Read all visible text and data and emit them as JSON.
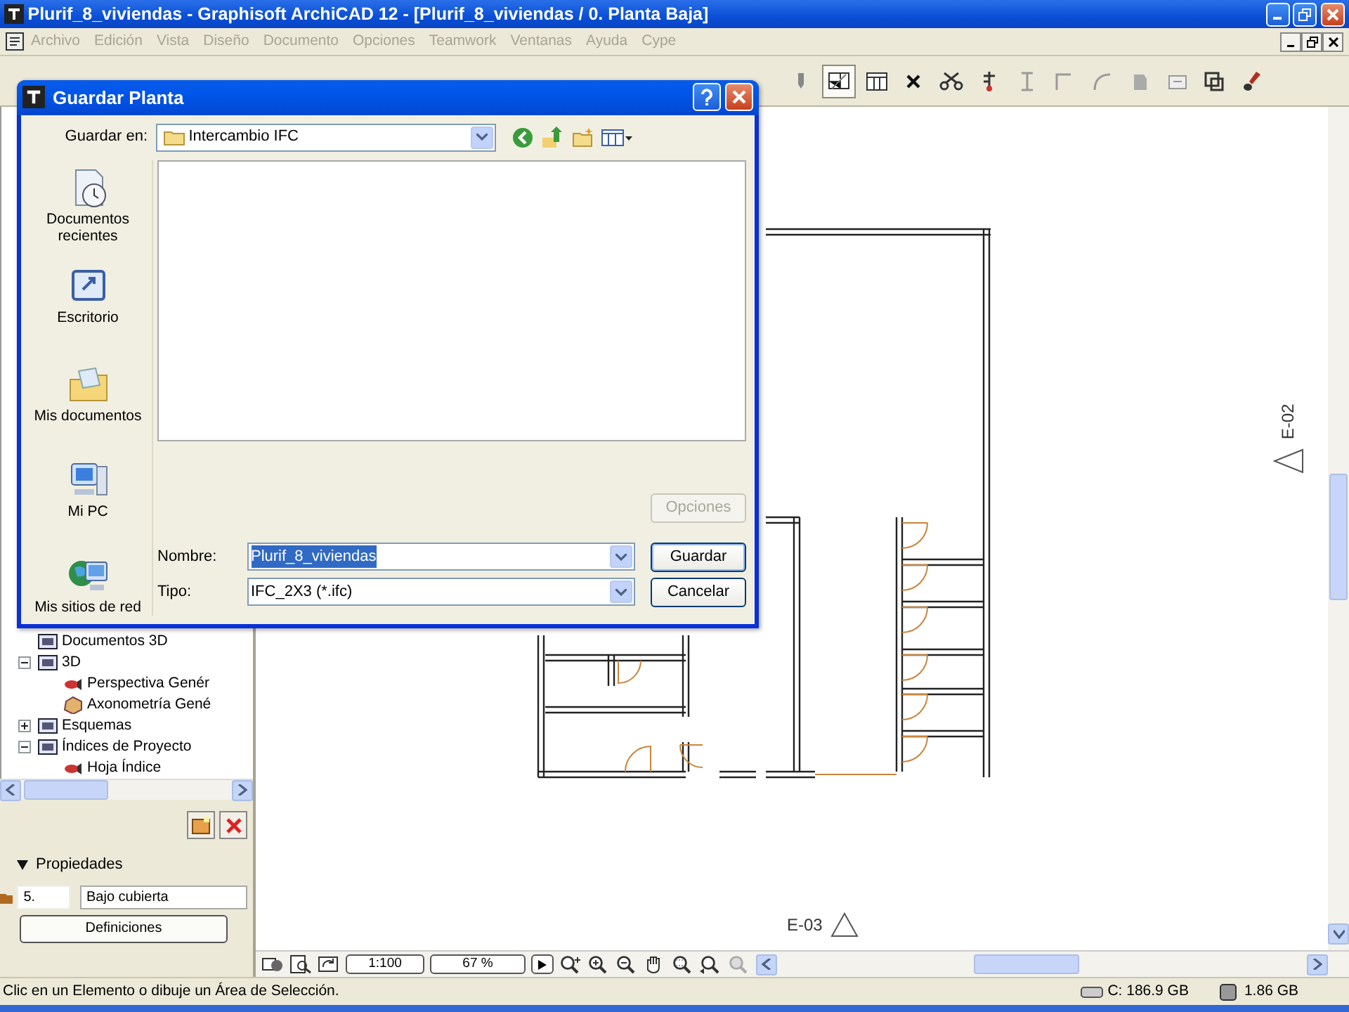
{
  "window": {
    "title": "Plurif_8_viviendas - Graphisoft ArchiCAD 12 - [Plurif_8_viviendas / 0. Planta Baja]"
  },
  "menu": [
    {
      "label": "Archivo",
      "disabled": true
    },
    {
      "label": "Edición",
      "disabled": true
    },
    {
      "label": "Vista",
      "disabled": true
    },
    {
      "label": "Diseño",
      "disabled": true
    },
    {
      "label": "Documento",
      "disabled": true
    },
    {
      "label": "Opciones",
      "disabled": true
    },
    {
      "label": "Teamwork",
      "disabled": true
    },
    {
      "label": "Ventanas",
      "disabled": true
    },
    {
      "label": "Ayuda",
      "disabled": true
    },
    {
      "label": "Cype",
      "disabled": true
    }
  ],
  "navigator": {
    "tree": [
      {
        "label": "Documentos 3D"
      },
      {
        "label": "3D",
        "expanded": true,
        "children": [
          {
            "label": "Perspectiva Genér"
          },
          {
            "label": "Axonometría Gené"
          }
        ]
      },
      {
        "label": "Esquemas",
        "expanded": false
      },
      {
        "label": "Índices de Proyecto",
        "expanded": true,
        "children": [
          {
            "label": "Hoja Índice"
          }
        ]
      }
    ]
  },
  "properties": {
    "header": "Propiedades",
    "expanded": true,
    "number": "5.",
    "name": "Bajo cubierta",
    "button": "Definiciones"
  },
  "canvas": {
    "markers": [
      {
        "label": "E-02",
        "kind": "vertical"
      },
      {
        "label": "E-03",
        "kind": "horizontal"
      }
    ]
  },
  "view_bar": {
    "scale": "1:100",
    "zoom": "67 %"
  },
  "status_bar": {
    "message": "Clic en un Elemento o dibuje un Área de Selección.",
    "disk": "C: 186.9 GB",
    "memory": "1.86 GB"
  },
  "dialog": {
    "title": "Guardar Planta",
    "save_in_label": "Guardar en:",
    "save_in": "Intercambio IFC",
    "places": [
      {
        "label": "Documentos recientes",
        "kind": "recent"
      },
      {
        "label": "Escritorio",
        "kind": "desktop"
      },
      {
        "label": "Mis documentos",
        "kind": "documents"
      },
      {
        "label": "Mi PC",
        "kind": "computer"
      },
      {
        "label": "Mis sitios de red",
        "kind": "network"
      }
    ],
    "options_button": {
      "label": "Opciones",
      "disabled": true
    },
    "filename_label": "Nombre:",
    "filename": "Plurif_8_viviendas",
    "filename_selected": true,
    "filetype_label": "Tipo:",
    "filetype": "IFC_2X3 (*.ifc)",
    "buttons": [
      {
        "label": "Guardar",
        "default": true
      },
      {
        "label": "Cancelar",
        "default": false
      }
    ]
  }
}
